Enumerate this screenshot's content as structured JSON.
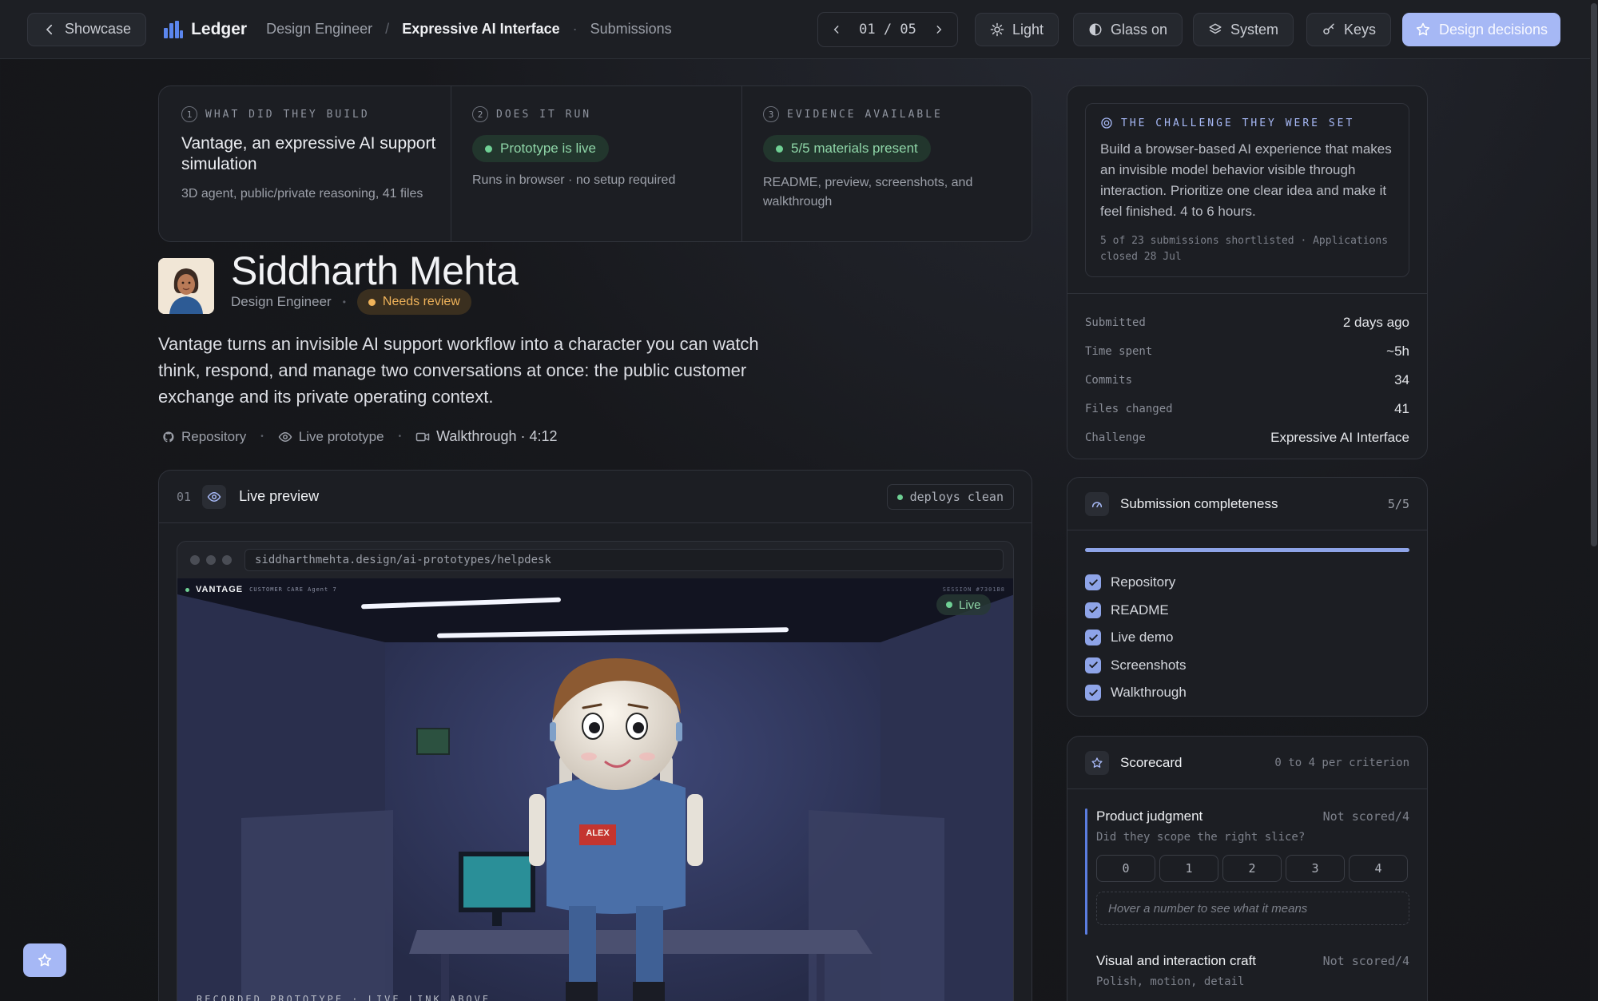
{
  "topbar": {
    "back_label": "Showcase",
    "brand": "Ledger",
    "crumb_role": "Design Engineer",
    "crumb_sep": "/",
    "crumb_challenge": "Expressive AI Interface",
    "crumb_dot": "·",
    "crumb_section": "Submissions",
    "pager_text": "01 / 05",
    "theme_label": "Light",
    "glass_label": "Glass on",
    "system_label": "System",
    "keys_label": "Keys",
    "primary_label": "Design decisions"
  },
  "summary": [
    {
      "num": "1",
      "caption": "WHAT DID THEY BUILD",
      "title": "Vantage, an expressive AI support simulation",
      "detail": "3D agent, public/private reasoning, 41 files"
    },
    {
      "num": "2",
      "caption": "DOES IT RUN",
      "pill": "Prototype is live",
      "detail": "Runs in browser · no setup required"
    },
    {
      "num": "3",
      "caption": "EVIDENCE AVAILABLE",
      "pill": "5/5 materials present",
      "detail": "README, preview, screenshots, and walkthrough"
    }
  ],
  "candidate": {
    "name": "Siddharth Mehta",
    "role": "Design Engineer",
    "status": "Needs review",
    "summary": "Vantage turns an invisible AI support workflow into a character you can watch think, respond, and manage two conversations at once: the public customer exchange and its private operating context.",
    "links": {
      "repo": "Repository",
      "live": "Live prototype",
      "walkthrough": "Walkthrough · 4:12"
    }
  },
  "preview": {
    "index": "01",
    "title": "Live preview",
    "badge": "deploys clean",
    "url": "siddharthmehta.design/ai-prototypes/helpdesk",
    "app_brand": "VANTAGE",
    "app_tabs": "CUSTOMER CARE    Agent 7",
    "session": "SESSION #7301B8",
    "live": "Live",
    "nametag": "ALEX",
    "caption": "RECORDED PROTOTYPE · LIVE LINK ABOVE"
  },
  "challenge": {
    "caption": "THE CHALLENGE THEY WERE SET",
    "text": "Build a browser-based AI experience that makes an invisible model behavior visible through interaction. Prioritize one clear idea and make it feel finished. 4 to 6 hours.",
    "meta": "5 of 23 submissions shortlisted · Applications closed 28 Jul",
    "stats": [
      {
        "label": "Submitted",
        "value": "2 days ago"
      },
      {
        "label": "Time spent",
        "value": "~5h"
      },
      {
        "label": "Commits",
        "value": "34"
      },
      {
        "label": "Files changed",
        "value": "41"
      },
      {
        "label": "Challenge",
        "value": "Expressive AI Interface"
      }
    ]
  },
  "completeness": {
    "title": "Submission completeness",
    "count": "5/5",
    "progress": 1.0,
    "items": [
      "Repository",
      "README",
      "Live demo",
      "Screenshots",
      "Walkthrough"
    ]
  },
  "scorecard": {
    "title": "Scorecard",
    "range": "0 to 4 per criterion",
    "criteria": [
      {
        "name": "Product judgment",
        "score": "Not scored/4",
        "question": "Did they scope the right slice?",
        "hint": "Hover a number to see what it means"
      },
      {
        "name": "Visual and interaction craft",
        "score": "Not scored/4",
        "question": "Polish, motion, detail"
      }
    ],
    "scale": [
      "0",
      "1",
      "2",
      "3",
      "4"
    ]
  },
  "colors": {
    "accent": "#a6b8f5",
    "success": "#8fd6a8",
    "warning": "#f0b35a"
  }
}
